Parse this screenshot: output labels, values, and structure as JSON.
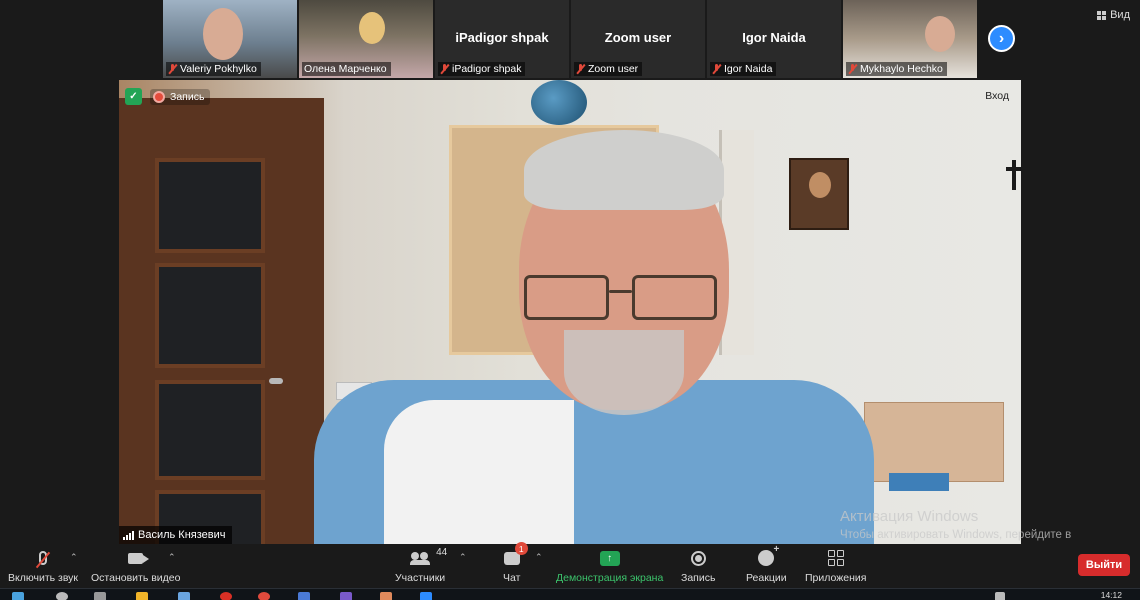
{
  "participants": [
    {
      "name": "Valeriy Pokhylko",
      "has_video": true,
      "muted": true
    },
    {
      "name": "Олена Марченко",
      "has_video": true,
      "muted": false
    },
    {
      "name": "iPadigor shpak",
      "center_label": "iPadigor shpak",
      "has_video": false,
      "muted": true
    },
    {
      "name": "Zoom user",
      "center_label": "Zoom user",
      "has_video": false,
      "muted": true
    },
    {
      "name": "Igor Naida",
      "center_label": "Igor Naida",
      "has_video": false,
      "muted": true
    },
    {
      "name": "Mykhaylo Hechko",
      "has_video": true,
      "muted": true
    }
  ],
  "view_label": "Вид",
  "next_page_icon": "chevron-right-icon",
  "main": {
    "recording_label": "Запись",
    "join_label": "Вход",
    "speaker_name": "Василь Князевич"
  },
  "watermark": {
    "title": "Активация Windows",
    "subtitle": "Чтобы активировать Windows, перейдите в раздел \"Параметры\"."
  },
  "toolbar": {
    "mic_label": "Включить звук",
    "video_label": "Остановить видео",
    "participants_label": "Участники",
    "participants_count": "44",
    "chat_label": "Чат",
    "chat_badge": "1",
    "share_label": "Демонстрация экрана",
    "record_label": "Запись",
    "reactions_label": "Реакции",
    "apps_label": "Приложения",
    "exit_label": "Выйти"
  },
  "taskbar": {
    "clock": "14:12"
  },
  "colors": {
    "accent_blue": "#2d8cff",
    "share_green": "#23a455",
    "exit_red": "#d72c2c",
    "muted_red": "#e0493a"
  }
}
